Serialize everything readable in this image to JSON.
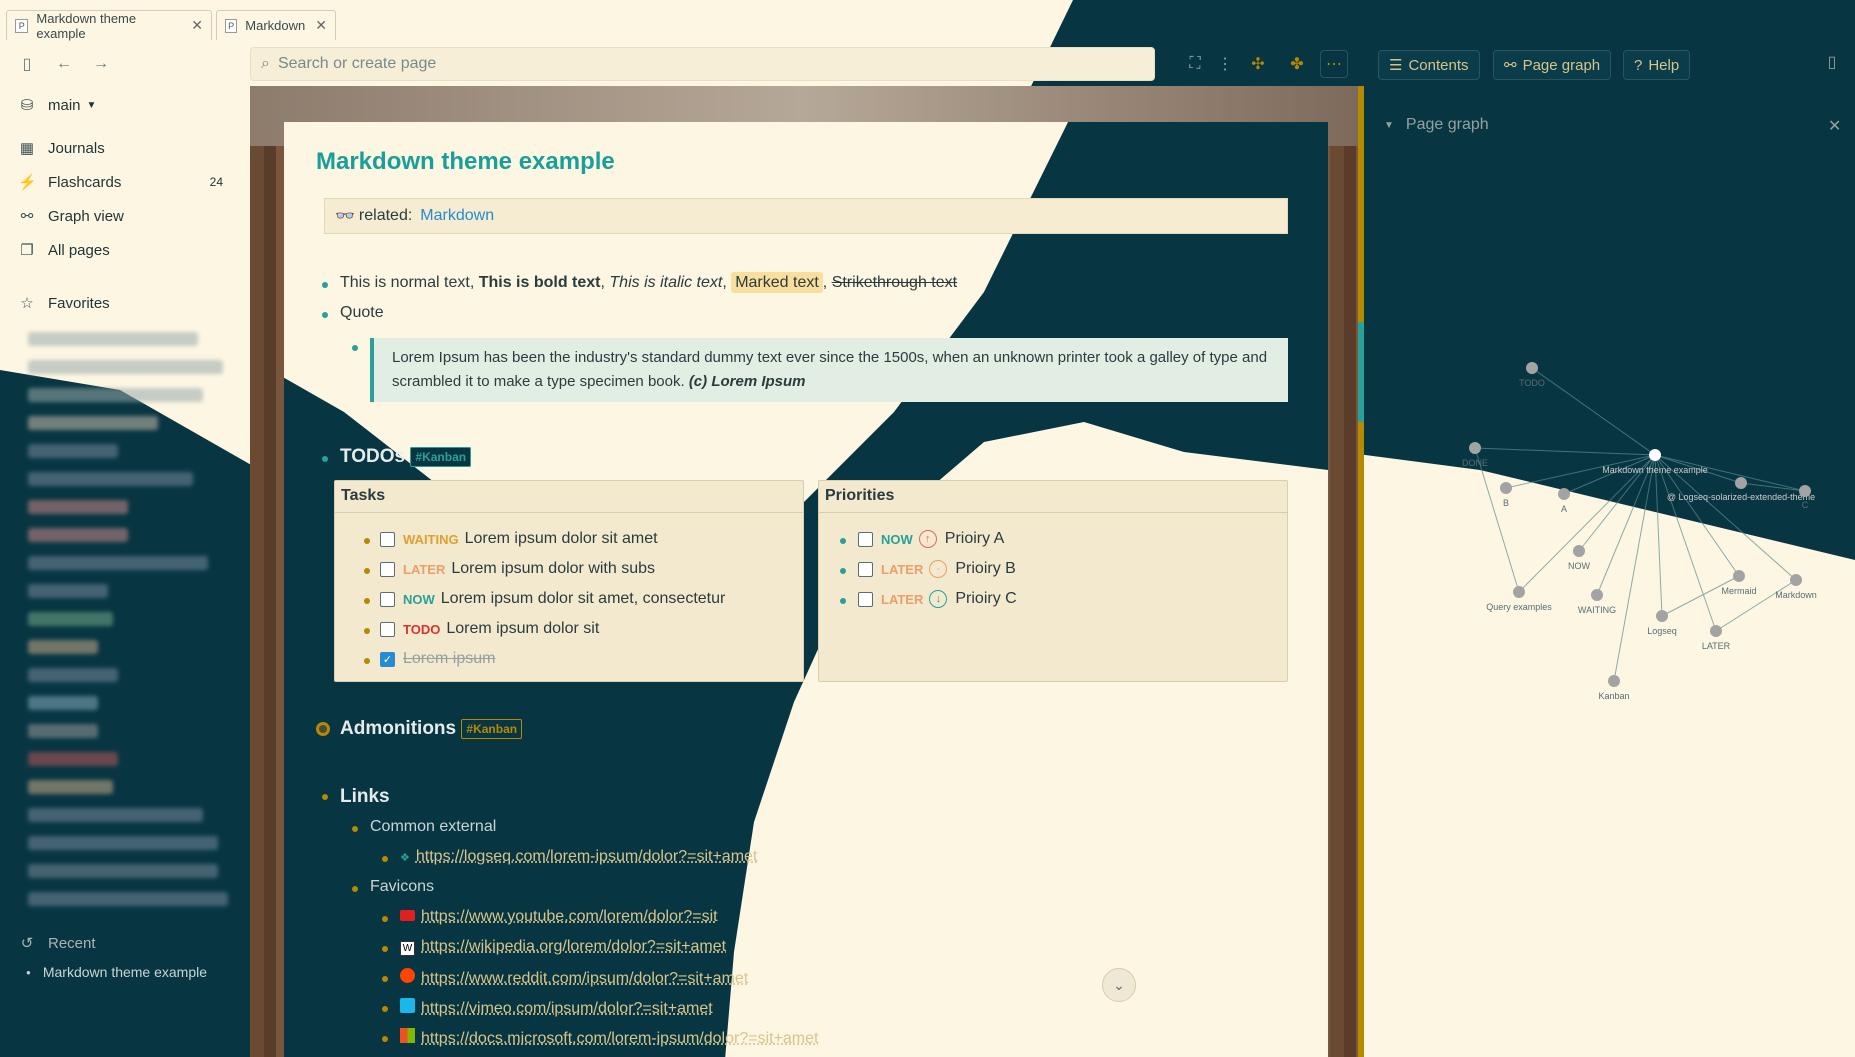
{
  "tabs": [
    {
      "label": "Markdown theme example"
    },
    {
      "label": "Markdown"
    }
  ],
  "search": {
    "placeholder": "Search or create page"
  },
  "toolbar": {
    "contents": "Contents",
    "page_graph": "Page graph",
    "help": "Help"
  },
  "sidebar": {
    "graph_name": "main",
    "nav": [
      {
        "label": "Journals"
      },
      {
        "label": "Flashcards",
        "count": "24"
      },
      {
        "label": "Graph view"
      },
      {
        "label": "All pages"
      }
    ],
    "favorites_label": "Favorites",
    "recent_label": "Recent",
    "recent_items": [
      "Markdown theme example"
    ]
  },
  "page": {
    "title": "Markdown theme example",
    "related_key": "related:",
    "related_value": "Markdown",
    "line1": {
      "normal": "This is normal text, ",
      "bold": "This is bold text",
      "sep1": ", ",
      "italic": "This is italic text",
      "sep2": ", ",
      "marked": "Marked text",
      "sep3": ", ",
      "strike": "Strikethrough text"
    },
    "quote_label": "Quote",
    "quote_text": "Lorem Ipsum has been the industry's standard dummy text ever since the 1500s, when an unknown printer took a galley of type and scrambled it to make a type specimen book. ",
    "quote_cite": "(c) Lorem Ipsum",
    "todos_heading": "TODOs",
    "kanban_tag": "#Kanban",
    "tasks_header": "Tasks",
    "tasks": [
      {
        "kw": "WAITING",
        "text": "Lorem ipsum dolor sit amet"
      },
      {
        "kw": "LATER",
        "text": "Lorem ipsum dolor with subs"
      },
      {
        "kw": "NOW",
        "text": "Lorem ipsum dolor sit amet, consectetur"
      },
      {
        "kw": "TODO",
        "text": "Lorem ipsum dolor sit"
      },
      {
        "kw": "",
        "text": "Lorem ipsum"
      }
    ],
    "priorities_header": "Priorities",
    "priorities": [
      {
        "kw": "NOW",
        "text": "Prioiry A"
      },
      {
        "kw": "LATER",
        "text": "Prioiry B"
      },
      {
        "kw": "LATER",
        "text": "Prioiry C"
      }
    ],
    "admonitions_heading": "Admonitions",
    "links_heading": "Links",
    "common_external": "Common external",
    "link_logseq": "https://logseq.com/lorem-ipsum/dolor?=sit+amet",
    "favicons": "Favicons",
    "favicon_links": [
      "https://www.youtube.com/lorem/dolor?=sit",
      "https://wikipedia.org/lorem/dolor?=sit+amet",
      "https://www.reddit.com/ipsum/dolor?=sit+amet",
      "https://vimeo.com/ipsum/dolor?=sit+amet",
      "https://docs.microsoft.com/lorem-ipsum/dolor?=sit+amet"
    ]
  },
  "graph_panel": {
    "title": "Page graph",
    "nodes": [
      "TODO",
      "DONE",
      "B",
      "A",
      "Markdown theme example",
      "@ Logseq-solarized-extended-theme",
      "C",
      "NOW",
      "Query examples",
      "WAITING",
      "Logseq",
      "LATER",
      "Mermaid",
      "Markdown",
      "Kanban"
    ]
  },
  "colors": {
    "accent": "#2aa198",
    "link": "#268bd2",
    "dark_bg": "#073642",
    "light_bg": "#fdf6e3",
    "gold": "#b58900"
  }
}
